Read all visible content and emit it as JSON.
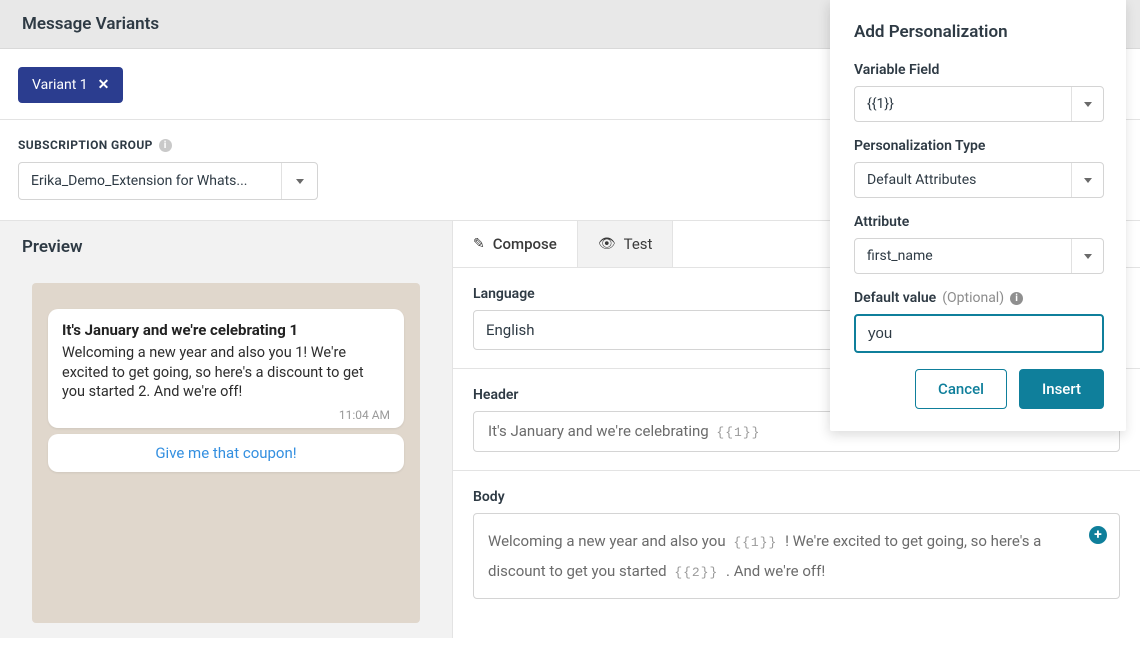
{
  "page_title": "Message Variants",
  "variant": {
    "label": "Variant 1",
    "close": "✕"
  },
  "subscription_group": {
    "label": "SUBSCRIPTION GROUP",
    "value": "Erika_Demo_Extension for Whats..."
  },
  "preview": {
    "label": "Preview",
    "bubble_title": "It's January and we're celebrating 1",
    "bubble_text": "Welcoming a new year and also you 1! We're excited to get going, so here's a discount to get you started 2. And we're off!",
    "time": "11:04 AM",
    "cta": "Give me that coupon!"
  },
  "tabs": {
    "compose": "Compose",
    "test": "Test"
  },
  "compose": {
    "language_label": "Language",
    "language_value": "English",
    "header_label": "Header",
    "header_prefix": "It's January and we're celebrating ",
    "header_ph1": "{{1}}",
    "body_label": "Body",
    "body_seg1": "Welcoming a new year and also you ",
    "body_ph1": "{{1}}",
    "body_seg2": " ! We're excited to get going, so here's a discount to get you started ",
    "body_ph2": "{{2}}",
    "body_seg3": " . And we're off!"
  },
  "panel": {
    "title": "Add Personalization",
    "variable_field_label": "Variable Field",
    "variable_field_value": "{{1}}",
    "ptype_label": "Personalization Type",
    "ptype_value": "Default Attributes",
    "attribute_label": "Attribute",
    "attribute_value": "first_name",
    "default_label": "Default value",
    "default_opt": "(Optional)",
    "default_value": "you",
    "cancel": "Cancel",
    "insert": "Insert"
  }
}
